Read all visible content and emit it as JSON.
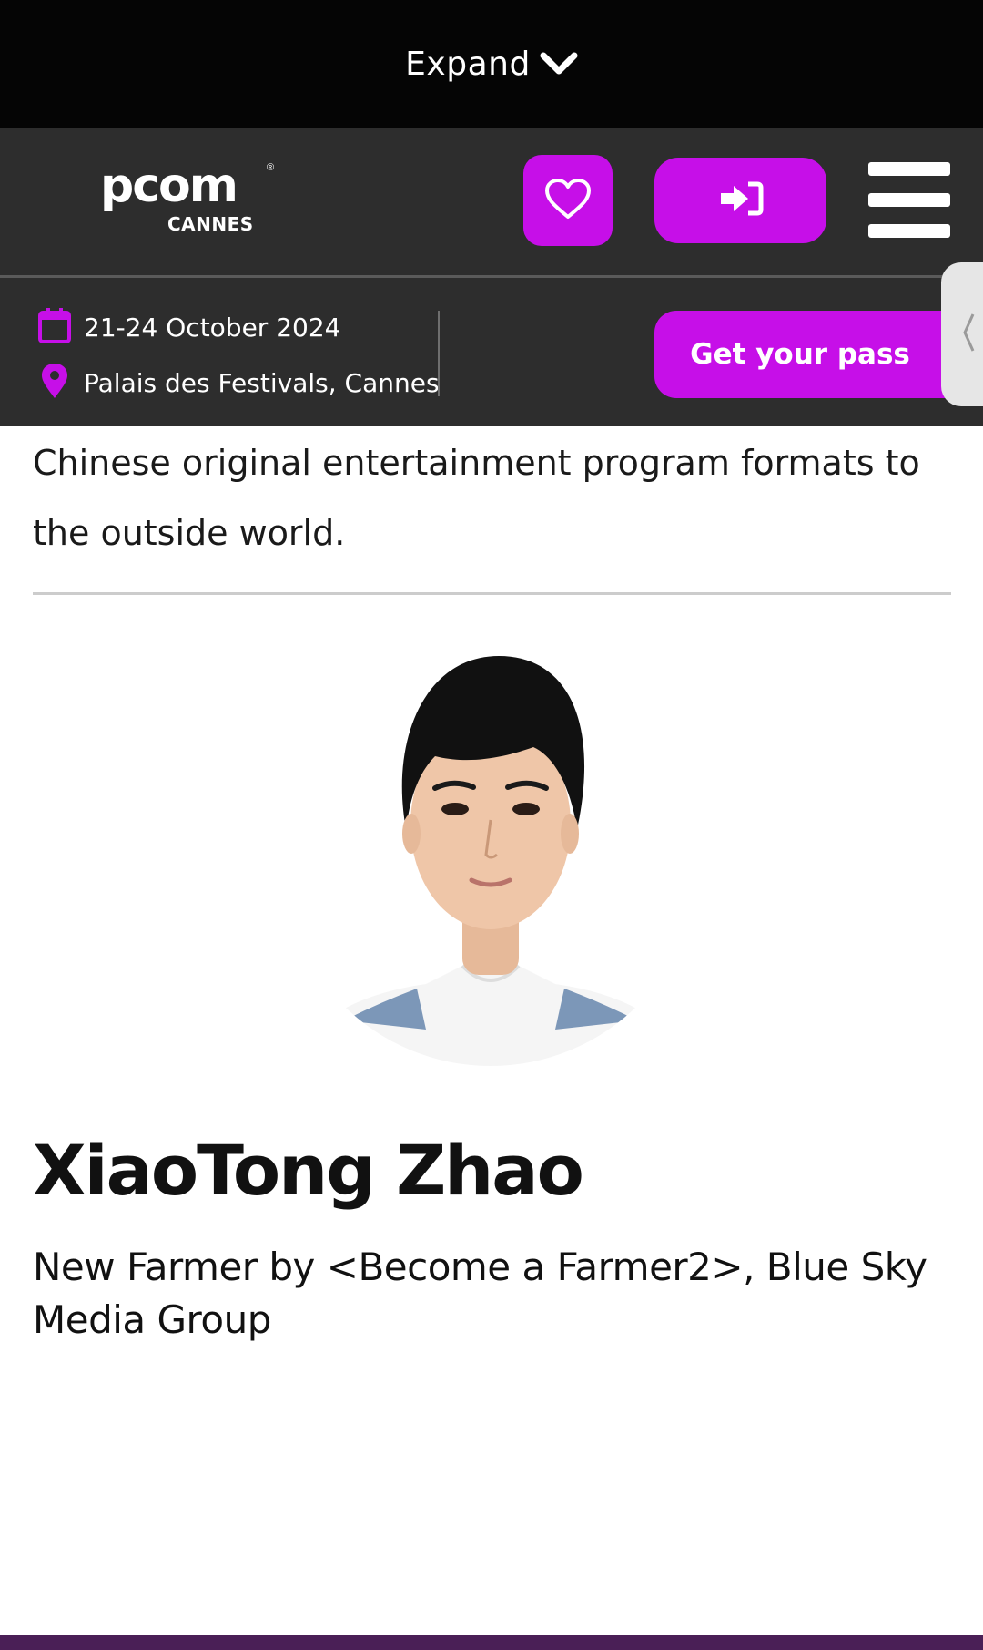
{
  "expand_bar": {
    "label": "Expand",
    "chevron_icon": "chevron-down-icon"
  },
  "header": {
    "logo": {
      "word": "pcom",
      "sub": "CANNES"
    },
    "favorites_icon": "heart-icon",
    "login_icon": "sign-in-icon",
    "menu_icon": "hamburger-menu-icon"
  },
  "event_info": {
    "date": "21-24 October 2024",
    "location": "Palais des Festivals, Cannes",
    "cta_label": "Get your pass",
    "date_icon": "calendar-icon",
    "location_icon": "map-pin-icon",
    "side_tab_icon": "chevron-left-icon"
  },
  "content": {
    "intro_text": "Chinese original entertainment program formats to the outside world.",
    "speaker": {
      "name": "XiaoTong Zhao",
      "role": "New Farmer by <Become a Farmer2>, Blue Sky Media Group"
    }
  },
  "colors": {
    "accent": "#c60fe8",
    "header_bg": "#2d2d2d",
    "top_bar_bg": "#050505"
  }
}
